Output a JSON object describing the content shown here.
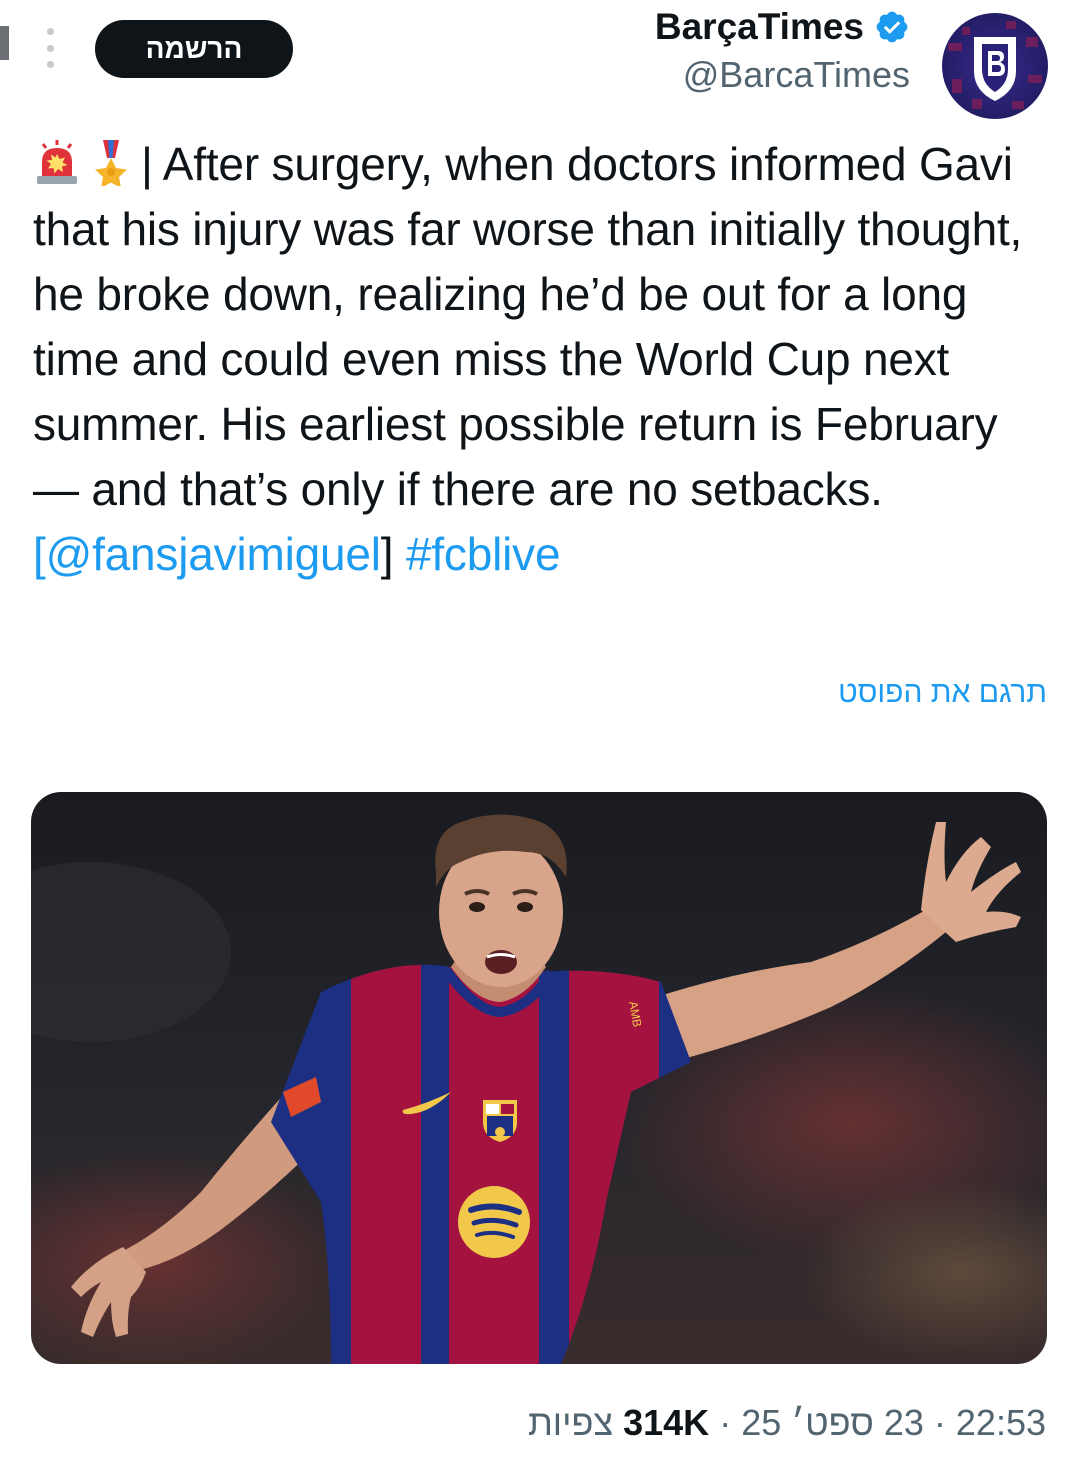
{
  "header": {
    "subscribe_label": "הרשמה",
    "display_name": "BarçaTimes",
    "handle": "@BarcaTimes"
  },
  "tweet": {
    "body": "| After surgery, when doctors informed Gavi that his injury was far worse than initially thought, he broke down, realizing he’d be out for a long time and could even miss the World Cup next summer. His earliest possible return is February — and that’s only if there are no setbacks.",
    "link_open": "[",
    "mention": "@fansjavimiguel",
    "link_close": "]",
    "hashtag": "#fcblive",
    "translate_label": "תרגם את הפוסט",
    "media_sponsor_mark": "AMB",
    "icons": [
      "siren-icon",
      "military-medal-icon",
      "verified-badge-icon",
      "more-options-icon"
    ]
  },
  "meta": {
    "time": "22:53",
    "date": "23 ספט׳ 25",
    "views_count": "314K",
    "views_label": "צפיות",
    "separator": "·"
  },
  "colors": {
    "accent": "#1d9bf0",
    "text": "#0f1419",
    "secondary": "#536471",
    "button_bg": "#0f1419",
    "barca_blue": "#1c2f83",
    "barca_red": "#a4123f"
  }
}
